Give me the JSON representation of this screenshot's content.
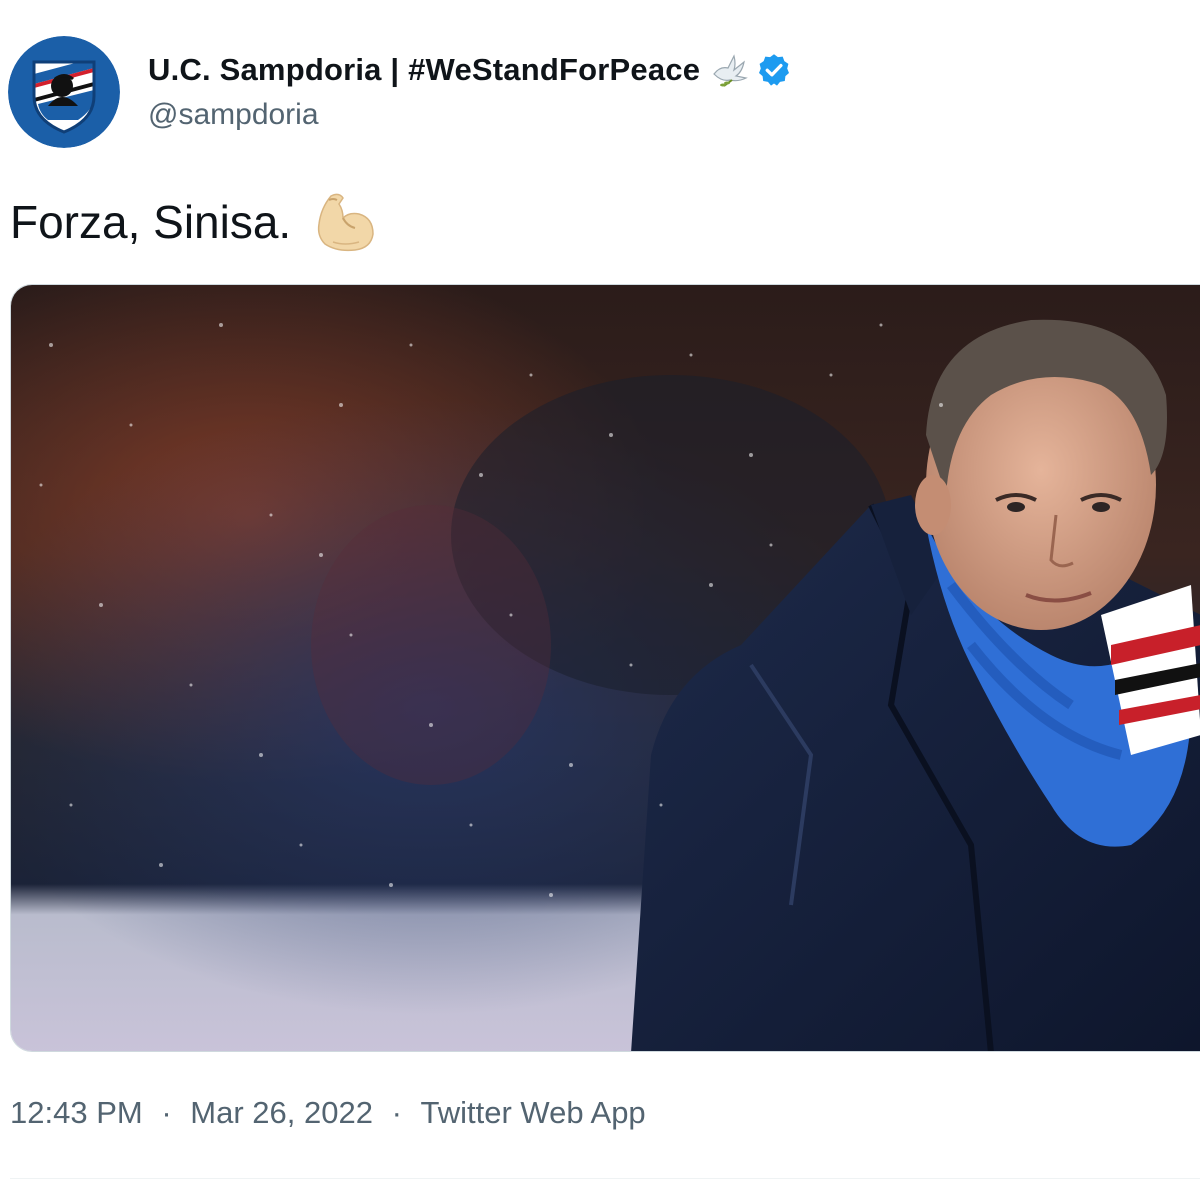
{
  "account": {
    "display_name": "U.C. Sampdoria | #WeStandForPeace",
    "handle": "@sampdoria",
    "verified": true,
    "avatar_icon": "sampdoria-crest-icon",
    "name_emoji_icon": "dove-icon"
  },
  "tweet": {
    "text": "Forza, Sinisa.",
    "text_emoji_icon": "flexed-biceps-icon"
  },
  "media": {
    "type": "photo",
    "subject": "coach-in-rain-photo"
  },
  "meta": {
    "time": "12:43 PM",
    "separator": "·",
    "date": "Mar 26, 2022",
    "source": "Twitter Web App"
  },
  "colors": {
    "text_primary": "#0f1419",
    "text_secondary": "#536471",
    "verified_blue": "#1d9bf0",
    "sampdoria_blue": "#1b5fa8"
  }
}
